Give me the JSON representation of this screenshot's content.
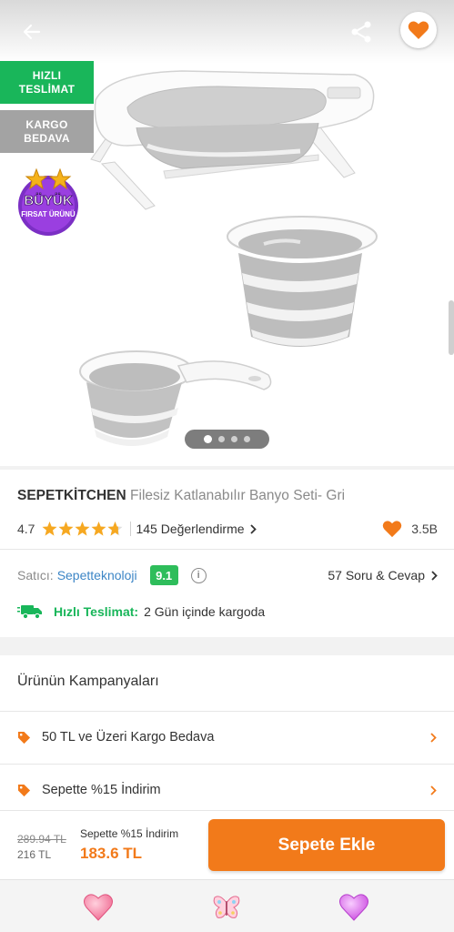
{
  "header": {
    "back_icon": "arrow-left-icon",
    "share_icon": "share-icon",
    "favorite_icon": "heart-icon",
    "accent_color": "#f27a1a"
  },
  "badges": {
    "fast_delivery": [
      "HIZLI",
      "TESLİMAT"
    ],
    "free_cargo": [
      "KARGO",
      "BEDAVA"
    ],
    "big_opportunity": [
      "BÜYÜK",
      "FIRSAT ÜRÜNÜ"
    ]
  },
  "gallery": {
    "image_count": 4,
    "active_index": 0
  },
  "product": {
    "brand": "SEPETKİTCHEN",
    "name": "Filesiz Katlanabılır Banyo Seti- Gri",
    "rating": "4.7",
    "rating_value": 4.7,
    "reviews_label": "145 Değerlendirme",
    "favorites_count": "3.5B"
  },
  "seller": {
    "label": "Satıcı:",
    "name": "Sepetteknoloji",
    "score": "9.1",
    "qa_label": "57 Soru & Cevap"
  },
  "shipping": {
    "label": "Hızlı Teslimat:",
    "value": "2 Gün içinde kargoda",
    "color": "#19b65a"
  },
  "campaigns": {
    "title": "Ürünün Kampanyaları",
    "items": [
      {
        "label": "50 TL ve Üzeri Kargo Bedava"
      },
      {
        "label": "Sepette %15 İndirim"
      }
    ]
  },
  "pricing": {
    "old_price": "289.94 TL",
    "price": "216 TL",
    "promo_label": "Sepette %15 İndirim",
    "promo_price": "183.6 TL",
    "add_to_cart": "Sepete Ekle"
  },
  "bottom_nav": {
    "icons": [
      "heart-icon",
      "butterfly-icon",
      "heart-icon"
    ]
  }
}
